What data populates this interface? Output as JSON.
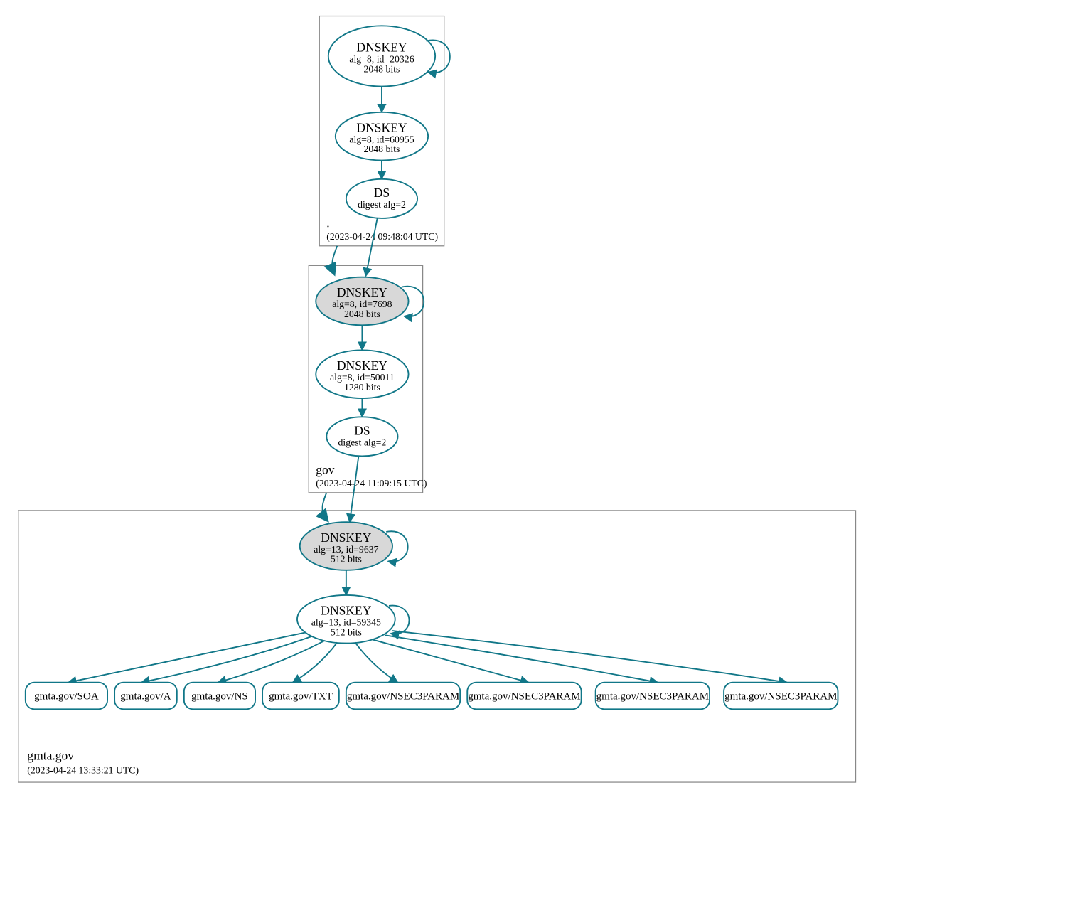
{
  "colors": {
    "stroke": "#117788",
    "ksk_fill": "#d8d8d8"
  },
  "zones": {
    "root": {
      "name": ".",
      "timestamp": "(2023-04-24 09:48:04 UTC)"
    },
    "gov": {
      "name": "gov",
      "timestamp": "(2023-04-24 11:09:15 UTC)"
    },
    "gmta": {
      "name": "gmta.gov",
      "timestamp": "(2023-04-24 13:33:21 UTC)"
    }
  },
  "nodes": {
    "root_ksk": {
      "title": "DNSKEY",
      "line2": "alg=8, id=20326",
      "line3": "2048 bits"
    },
    "root_zsk": {
      "title": "DNSKEY",
      "line2": "alg=8, id=60955",
      "line3": "2048 bits"
    },
    "root_ds": {
      "title": "DS",
      "line2": "digest alg=2"
    },
    "gov_ksk": {
      "title": "DNSKEY",
      "line2": "alg=8, id=7698",
      "line3": "2048 bits"
    },
    "gov_zsk": {
      "title": "DNSKEY",
      "line2": "alg=8, id=50011",
      "line3": "1280 bits"
    },
    "gov_ds": {
      "title": "DS",
      "line2": "digest alg=2"
    },
    "gmta_ksk": {
      "title": "DNSKEY",
      "line2": "alg=13, id=9637",
      "line3": "512 bits"
    },
    "gmta_zsk": {
      "title": "DNSKEY",
      "line2": "alg=13, id=59345",
      "line3": "512 bits"
    }
  },
  "records": [
    "gmta.gov/SOA",
    "gmta.gov/A",
    "gmta.gov/NS",
    "gmta.gov/TXT",
    "gmta.gov/NSEC3PARAM",
    "gmta.gov/NSEC3PARAM",
    "gmta.gov/NSEC3PARAM",
    "gmta.gov/NSEC3PARAM"
  ]
}
